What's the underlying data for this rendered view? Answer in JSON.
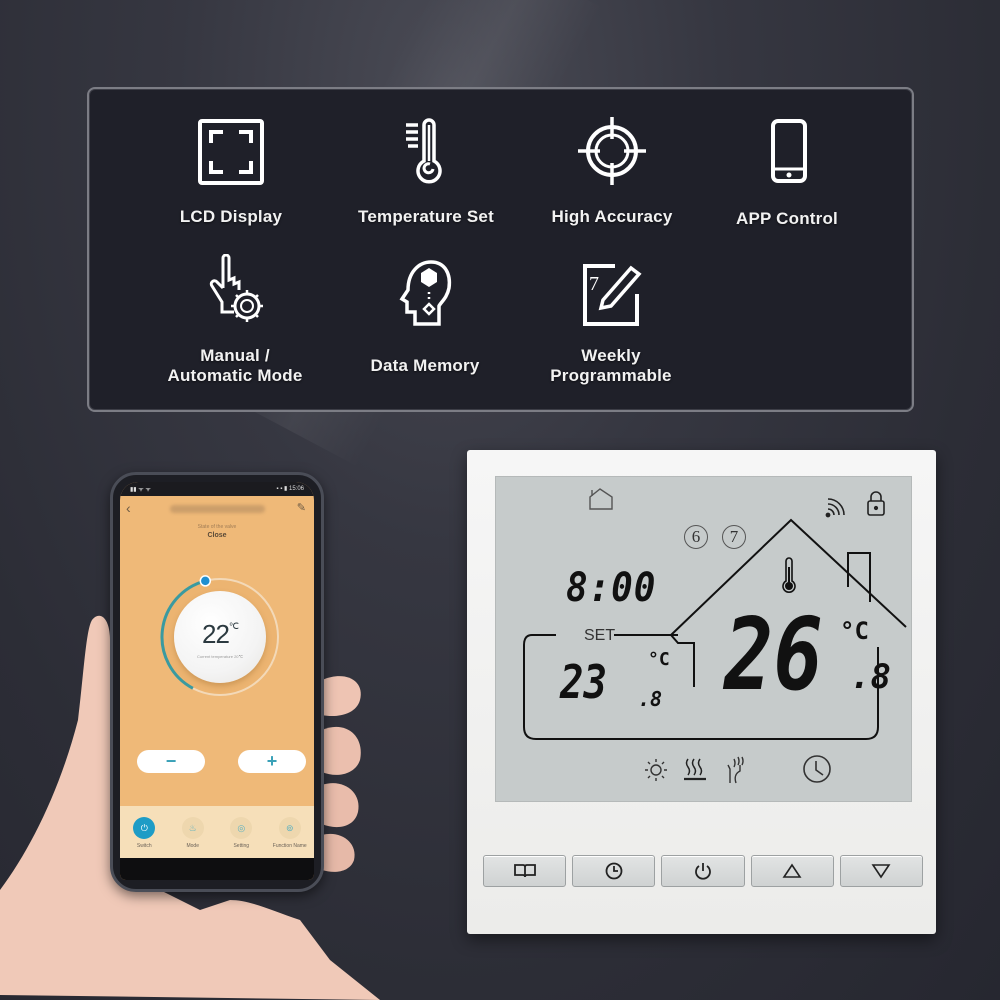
{
  "features": {
    "items": [
      {
        "label": "LCD Display",
        "icon": "lcd-display-icon"
      },
      {
        "label": "Temperature Set",
        "icon": "thermometer-icon"
      },
      {
        "label": "High Accuracy",
        "icon": "crosshair-target-icon"
      },
      {
        "label": "APP Control",
        "icon": "smartphone-icon"
      },
      {
        "label_line1": "Manual /",
        "label_line2": "Automatic Mode",
        "icon": "hand-gear-icon"
      },
      {
        "label": "Data Memory",
        "icon": "head-memory-icon"
      },
      {
        "label_line1": "Weekly",
        "label_line2": "Programmable",
        "icon": "calendar-pencil-icon"
      }
    ]
  },
  "phone_app": {
    "status_left": "▮▮ ᯤ ᯤ",
    "status_right": "▪ ▪ ▮ 15:06",
    "back_icon": "‹",
    "edit_icon": "✎",
    "state_label": "State of the valve",
    "state_value": "Close",
    "set_temperature": "22",
    "set_temperature_unit": "℃",
    "current_temperature_text": "Current temperature 20℃",
    "dial_progress": 0.55,
    "minus_label": "−",
    "plus_label": "+",
    "tabs": [
      {
        "label": "Switch",
        "icon": "⏻",
        "active": true
      },
      {
        "label": "Mode",
        "icon": "♨",
        "active": false
      },
      {
        "label": "Setting",
        "icon": "◎",
        "active": false
      },
      {
        "label": "Function Name",
        "icon": "⊚",
        "active": false
      }
    ],
    "colors": {
      "background": "#efb978",
      "accent": "#1e9cc6",
      "dial_track": "#3a9aa0"
    }
  },
  "thermostat": {
    "clock": "8:00",
    "days": [
      "6",
      "7"
    ],
    "set_label": "SET",
    "set_temperature": "23",
    "set_decimal": "8",
    "unit": "°C",
    "room_temperature": "26",
    "room_decimal": "8",
    "buttons": [
      {
        "name": "menu-book-button",
        "glyph": "🕮"
      },
      {
        "name": "clock-button",
        "glyph": "◷"
      },
      {
        "name": "power-button",
        "glyph": "⏻"
      },
      {
        "name": "up-button",
        "glyph": "△"
      },
      {
        "name": "down-button",
        "glyph": "▽"
      }
    ]
  }
}
